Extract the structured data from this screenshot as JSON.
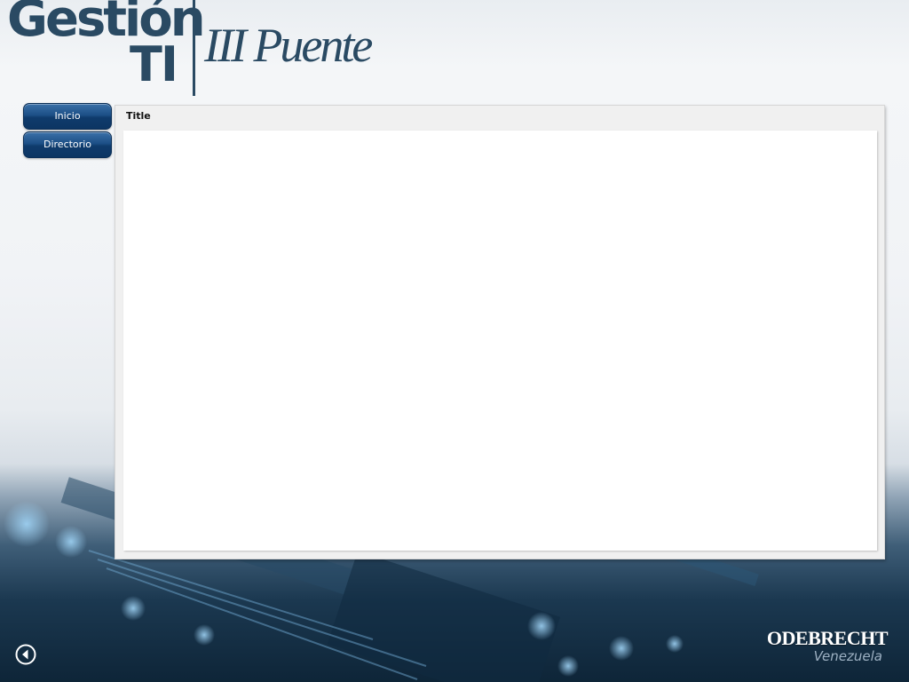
{
  "header": {
    "logo_main": "Gestión",
    "logo_ti": "TI",
    "logo_subtitle": "III Puente"
  },
  "nav": {
    "items": [
      {
        "label": "Inicio"
      },
      {
        "label": "Directorio"
      }
    ]
  },
  "panel": {
    "title": "Title"
  },
  "footer": {
    "back_icon": "back-arrow-icon",
    "brand_name": "ODEBRECHT",
    "brand_sub": "Venezuela"
  },
  "colors": {
    "logo": "#2a4a63",
    "button": "#1c4f86",
    "brand": "#ffffff"
  }
}
